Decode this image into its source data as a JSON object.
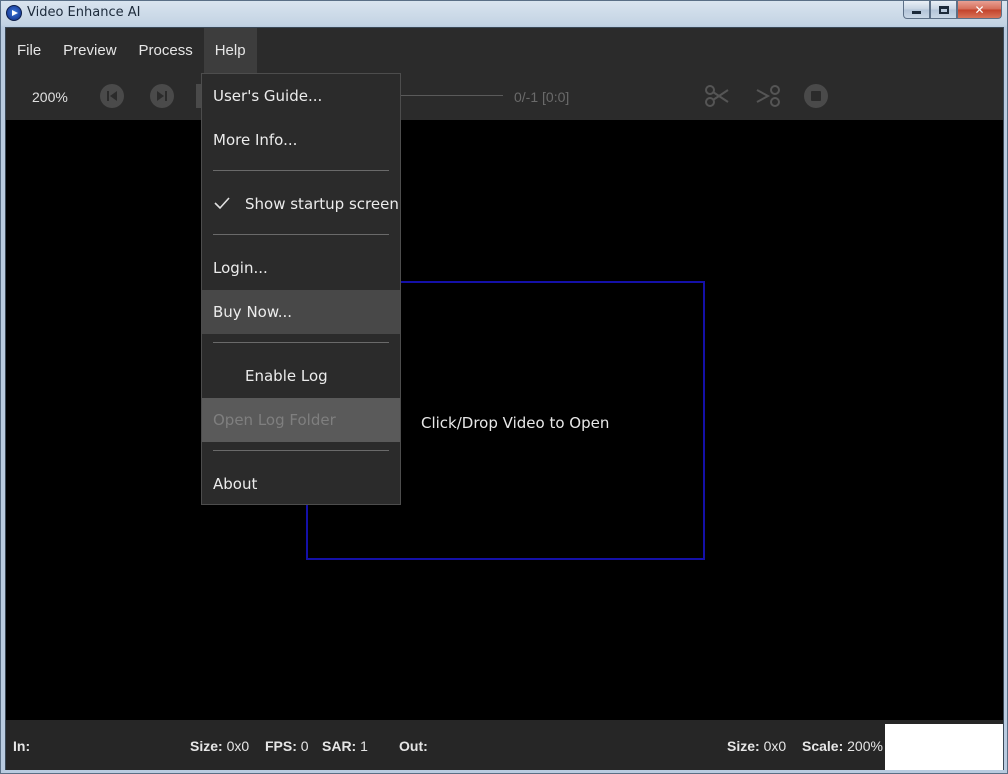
{
  "window": {
    "title": "Video Enhance AI"
  },
  "menubar": {
    "items": [
      "File",
      "Preview",
      "Process",
      "Help"
    ]
  },
  "toolbar": {
    "zoom": "200%",
    "frame_counter": "0/-1  [0:0]"
  },
  "help_menu": {
    "users_guide": "User's Guide...",
    "more_info": "More Info...",
    "show_startup": "Show startup screen",
    "show_startup_checked": true,
    "login": "Login...",
    "buy_now": "Buy Now...",
    "enable_log": "Enable Log",
    "open_log_folder": "Open Log Folder",
    "about": "About"
  },
  "main": {
    "drop_prompt": "Click/Drop Video to Open"
  },
  "statusbar": {
    "in_label": "In:",
    "in_size_label": "Size:",
    "in_size": "0x0",
    "fps_label": "FPS:",
    "fps": "0",
    "sar_label": "SAR:",
    "sar": "1",
    "out_label": "Out:",
    "out_size_label": "Size:",
    "out_size": "0x0",
    "scale_label": "Scale:",
    "scale": "200%"
  },
  "colors": {
    "drop_zone_border": "#1410a8",
    "menu_bg": "#2b2b2b",
    "menu_hover": "#484848"
  }
}
